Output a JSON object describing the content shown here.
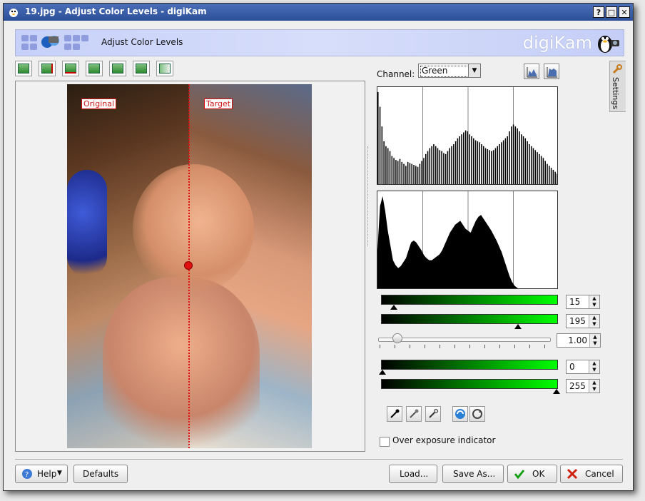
{
  "window": {
    "title": "19.jpg - Adjust Color Levels - digiKam",
    "help_button": "?",
    "maximize_button": "□",
    "close_button": "✕"
  },
  "banner": {
    "title": "Adjust Color Levels",
    "brand": "digiKam"
  },
  "toolbar": {
    "icons": [
      "original-image-icon",
      "split-vertical-icon",
      "split-horizontal-icon",
      "separate-vertical-icon",
      "separate-horizontal-icon",
      "target-image-icon",
      "under-over-exposure-icon"
    ]
  },
  "preview": {
    "original_label": "Original",
    "target_label": "Target"
  },
  "channel": {
    "label": "Channel:",
    "selected": "Green"
  },
  "side_tab": {
    "label": "Settings"
  },
  "levels": {
    "input_low": "15",
    "input_high": "195",
    "gamma": "1.00",
    "output_low": "0",
    "output_high": "255",
    "gradient_color": "#00ff00"
  },
  "histogram_top": [
    95,
    80,
    60,
    45,
    40,
    38,
    35,
    30,
    28,
    26,
    25,
    27,
    24,
    22,
    20,
    24,
    23,
    22,
    21,
    20,
    19,
    22,
    25,
    28,
    32,
    35,
    38,
    40,
    42,
    40,
    38,
    36,
    35,
    33,
    32,
    35,
    38,
    40,
    42,
    45,
    48,
    50,
    52,
    54,
    56,
    55,
    52,
    50,
    48,
    46,
    45,
    44,
    42,
    40,
    38,
    37,
    36,
    35,
    36,
    38,
    40,
    42,
    44,
    46,
    48,
    50,
    55,
    60,
    62,
    60,
    58,
    55,
    52,
    50,
    48,
    45,
    42,
    40,
    38,
    36,
    34,
    32,
    30,
    28,
    25,
    22,
    20,
    18,
    16,
    14,
    12
  ],
  "histogram_bottom": [
    40,
    85,
    95,
    80,
    60,
    45,
    30,
    25,
    22,
    24,
    28,
    32,
    40,
    48,
    50,
    48,
    44,
    40,
    35,
    32,
    30,
    30,
    32,
    34,
    36,
    40,
    46,
    52,
    58,
    62,
    66,
    68,
    70,
    66,
    62,
    60,
    58,
    64,
    70,
    74,
    76,
    72,
    68,
    64,
    60,
    55,
    50,
    44,
    38,
    30,
    22,
    14,
    8,
    4,
    2,
    0,
    0,
    0,
    0,
    0,
    0,
    0,
    0,
    0,
    0,
    0,
    0,
    0,
    0,
    0
  ],
  "checkbox": {
    "label": "Over exposure indicator"
  },
  "buttons": {
    "help": "Help",
    "defaults": "Defaults",
    "load": "Load...",
    "save_as": "Save As...",
    "ok": "OK",
    "cancel": "Cancel"
  }
}
